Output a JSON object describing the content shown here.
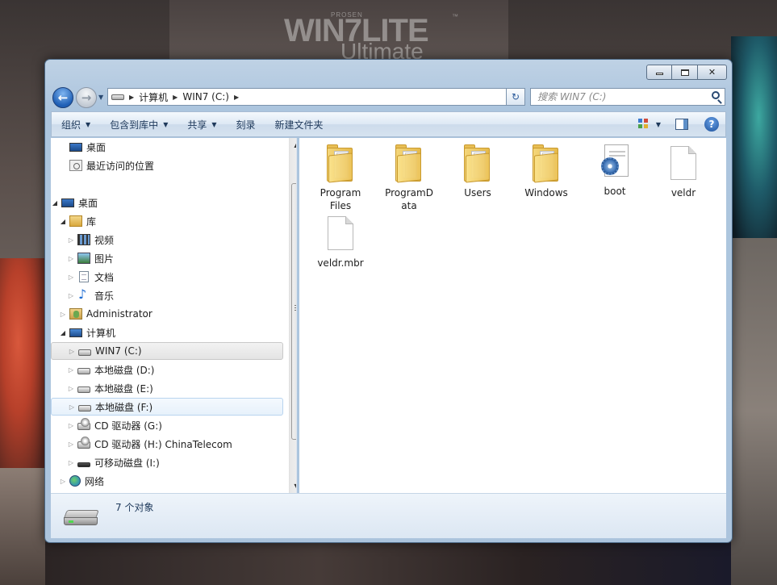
{
  "desktop": {
    "brand_prosen": "PROSEN",
    "brand_main": "WIN7LITE",
    "brand_tm": "™",
    "brand_sub": "Ultimate"
  },
  "window": {
    "caption_buttons": {
      "minimize": "minimize-icon",
      "maximize": "maximize-icon",
      "close": "✕"
    }
  },
  "nav": {
    "back_icon": "←",
    "forward_icon": "→",
    "history_drop": "▼"
  },
  "address": {
    "sep": "▶",
    "crumbs": [
      "计算机",
      "WIN7 (C:)"
    ],
    "drop": "▼",
    "refresh_icon": "↻"
  },
  "search": {
    "placeholder": "搜索 WIN7 (C:)"
  },
  "toolbar": {
    "caret": "▼",
    "items": [
      "组织",
      "包含到库中",
      "共享",
      "刻录",
      "新建文件夹"
    ],
    "help": "?"
  },
  "navpane": {
    "twisty_closed": "▷",
    "twisty_open": "◢",
    "items": [
      {
        "label": "桌面",
        "icon": "desktop-icon"
      },
      {
        "label": "最近访问的位置",
        "icon": "recent-places-icon"
      },
      {
        "label": "桌面",
        "icon": "desktop-icon"
      },
      {
        "label": "库",
        "icon": "library-icon"
      },
      {
        "label": "视频",
        "icon": "video-icon"
      },
      {
        "label": "图片",
        "icon": "picture-icon"
      },
      {
        "label": "文档",
        "icon": "document-icon"
      },
      {
        "label": "音乐",
        "icon": "music-icon"
      },
      {
        "label": "Administrator",
        "icon": "user-folder-icon"
      },
      {
        "label": "计算机",
        "icon": "computer-icon"
      },
      {
        "label": "WIN7 (C:)",
        "icon": "drive-icon"
      },
      {
        "label": "本地磁盘 (D:)",
        "icon": "drive-icon"
      },
      {
        "label": "本地磁盘 (E:)",
        "icon": "drive-icon"
      },
      {
        "label": "本地磁盘 (F:)",
        "icon": "drive-icon"
      },
      {
        "label": "CD 驱动器 (G:)",
        "icon": "cd-drive-icon"
      },
      {
        "label": "CD 驱动器 (H:) ChinaTelecom",
        "icon": "cd-drive-icon"
      },
      {
        "label": "可移动磁盘 (I:)",
        "icon": "removable-drive-icon"
      },
      {
        "label": "网络",
        "icon": "network-icon"
      }
    ],
    "scroll_up": "▲",
    "scroll_down": "▼"
  },
  "content": {
    "items": [
      {
        "label": "Program Files",
        "type": "folder"
      },
      {
        "label": "ProgramData",
        "type": "folder"
      },
      {
        "label": "Users",
        "type": "folder"
      },
      {
        "label": "Windows",
        "type": "folder"
      },
      {
        "label": "boot",
        "type": "system-file"
      },
      {
        "label": "veldr",
        "type": "file"
      },
      {
        "label": "veldr.mbr",
        "type": "file"
      }
    ]
  },
  "details": {
    "count": "7 个对象",
    "icon": "hard-drive-icon"
  }
}
